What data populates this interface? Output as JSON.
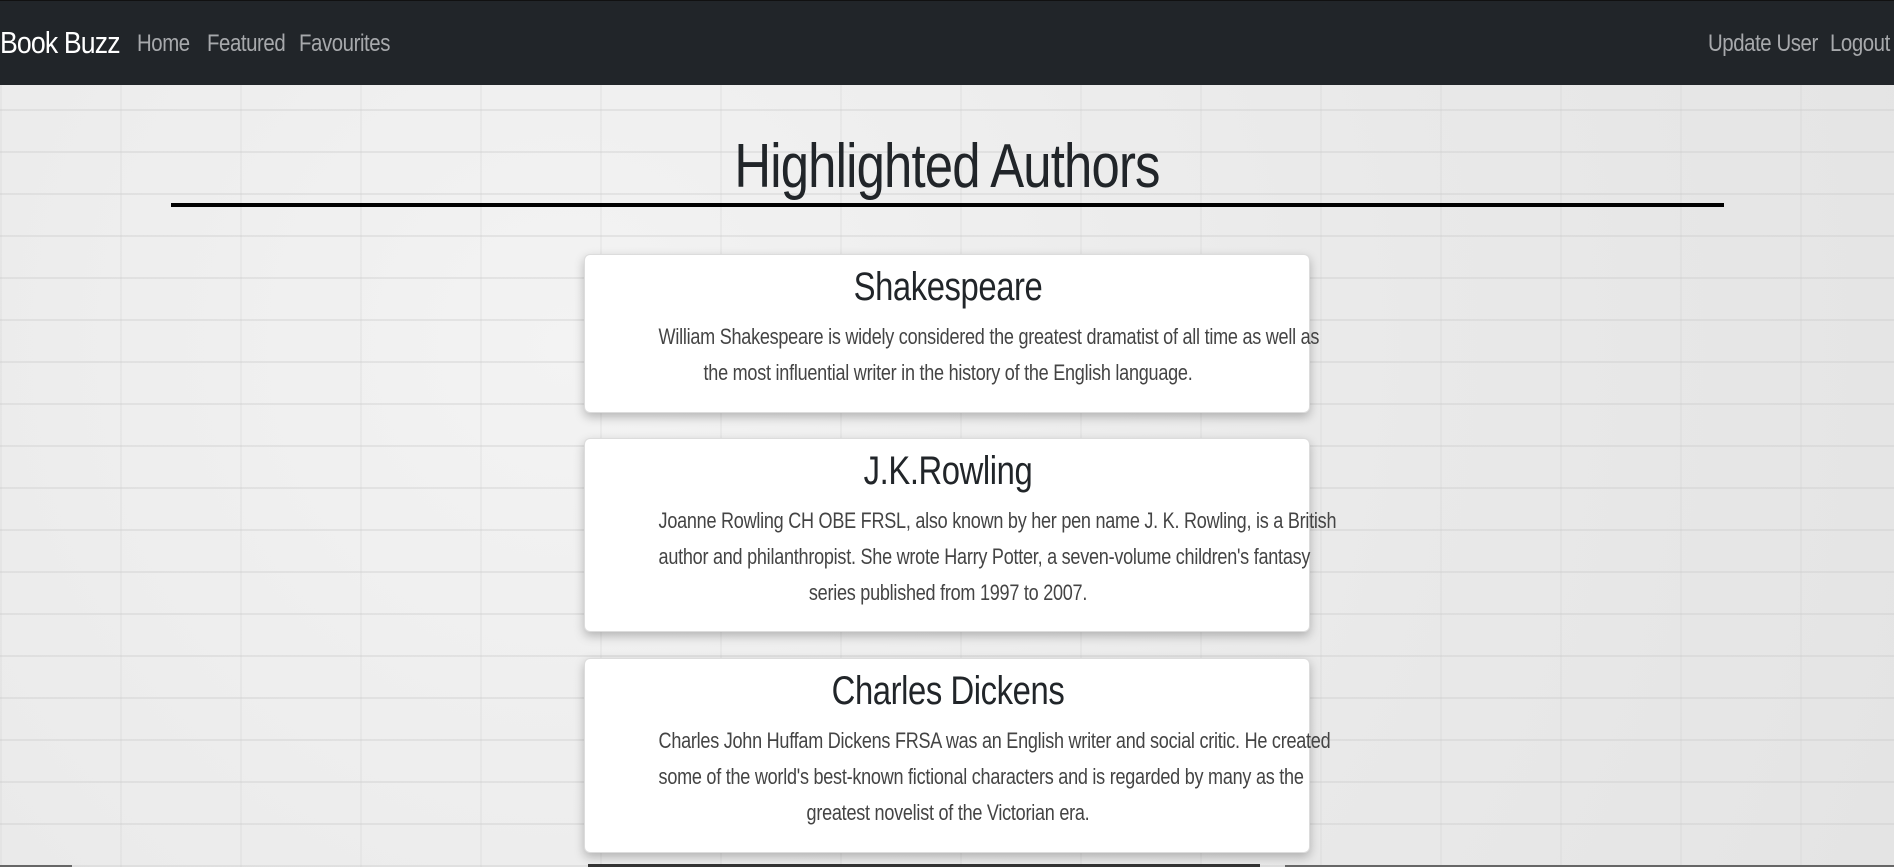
{
  "navbar": {
    "brand": "Book Buzz",
    "links": {
      "home": "Home",
      "featured": "Featured",
      "favourites": "Favourites",
      "update_user": "Update User",
      "logout": "Logout"
    }
  },
  "main": {
    "title": "Highlighted Authors",
    "authors": [
      {
        "name": "Shakespeare",
        "description_lines": [
          "William Shakespeare is widely considered the greatest dramatist of all time as well as",
          "the most influential writer in the history of the English language."
        ]
      },
      {
        "name": "J.K.Rowling",
        "description_lines": [
          "Joanne Rowling CH OBE FRSL, also known by her pen name J. K. Rowling, is a British",
          "author and philanthropist. She wrote Harry Potter, a seven-volume children's fantasy",
          "series published from 1997 to 2007."
        ]
      },
      {
        "name": "Charles Dickens",
        "description_lines": [
          "Charles John Huffam Dickens FRSA was an English writer and social critic. He created",
          "some of the world's best-known fictional characters and is regarded by many as the",
          "greatest novelist of the Victorian era."
        ]
      }
    ]
  },
  "colors": {
    "navbar_bg": "#212529",
    "nav_link": "#a7a9ac",
    "brand": "#ffffff",
    "page_bg": "#ececec",
    "card_bg": "#ffffff",
    "title_rule": "#000000"
  }
}
